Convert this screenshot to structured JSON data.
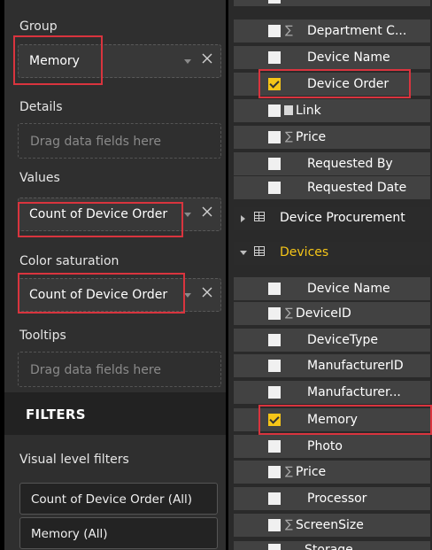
{
  "left_panel": {
    "group": {
      "label": "Group",
      "value": "Memory"
    },
    "details": {
      "label": "Details",
      "placeholder": "Drag data fields here"
    },
    "values": {
      "label": "Values",
      "value": "Count of Device Order"
    },
    "color_saturation": {
      "label": "Color saturation",
      "value": "Count of Device Order"
    },
    "tooltips": {
      "label": "Tooltips",
      "placeholder": "Drag data fields here"
    },
    "filters_header": "FILTERS",
    "visual_level_filters": {
      "label": "Visual level filters",
      "items": [
        "Count of Device Order (All)",
        "Memory (All)"
      ]
    }
  },
  "fields_panel": {
    "top_fields": [
      {
        "label": "Department C...",
        "sigma": true,
        "checked": false
      },
      {
        "label": "Device Name",
        "sigma": false,
        "checked": false
      },
      {
        "label": "Device Order",
        "sigma": false,
        "checked": true
      },
      {
        "label": "Link",
        "sigma": false,
        "checked": false,
        "link_icon": true
      },
      {
        "label": "Price",
        "sigma": true,
        "checked": false
      },
      {
        "label": "Requested By",
        "sigma": false,
        "checked": false
      },
      {
        "label": "Requested Date",
        "sigma": false,
        "checked": false
      }
    ],
    "tables": [
      {
        "label": "Device Procurement",
        "expanded": false,
        "highlight": false
      },
      {
        "label": "Devices",
        "expanded": true,
        "highlight": true
      }
    ],
    "devices_fields": [
      {
        "label": "Device Name",
        "sigma": false,
        "checked": false
      },
      {
        "label": "DeviceID",
        "sigma": true,
        "checked": false
      },
      {
        "label": "DeviceType",
        "sigma": false,
        "checked": false
      },
      {
        "label": "ManufacturerID",
        "sigma": false,
        "checked": false
      },
      {
        "label": "Manufacturer...",
        "sigma": false,
        "checked": false
      },
      {
        "label": "Memory",
        "sigma": false,
        "checked": true
      },
      {
        "label": "Photo",
        "sigma": false,
        "checked": false
      },
      {
        "label": "Price",
        "sigma": true,
        "checked": false
      },
      {
        "label": "Processor",
        "sigma": false,
        "checked": false
      },
      {
        "label": "ScreenSize",
        "sigma": true,
        "checked": false
      },
      {
        "label": "Storage",
        "sigma": false,
        "checked": false
      }
    ],
    "sigma_glyph": "∑"
  },
  "colors": {
    "panel_bg": "#2f2f2f",
    "field_row_bg": "#424242",
    "checkbox_checked": "#f5c518",
    "table_highlight": "#f5c518",
    "annotation_red": "#d9343e"
  }
}
